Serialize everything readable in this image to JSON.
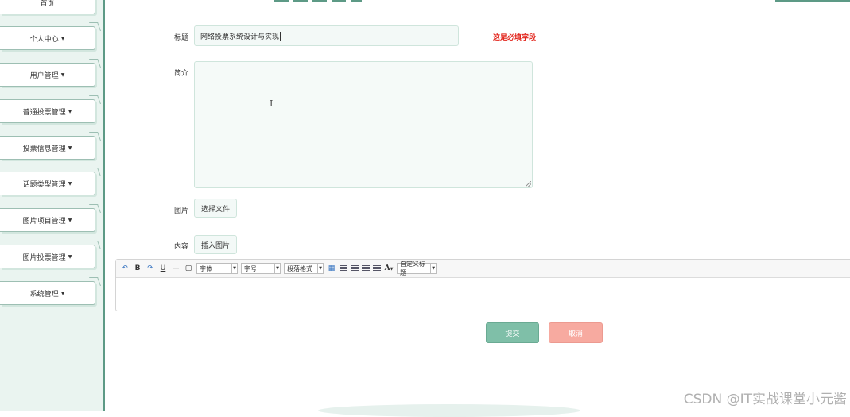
{
  "sidebar": {
    "items": [
      {
        "label": "首页",
        "caret": false
      },
      {
        "label": "个人中心",
        "caret": true
      },
      {
        "label": "用户管理",
        "caret": true
      },
      {
        "label": "普通投票管理",
        "caret": true
      },
      {
        "label": "投票信息管理",
        "caret": true
      },
      {
        "label": "话题类型管理",
        "caret": true
      },
      {
        "label": "图片项目管理",
        "caret": true
      },
      {
        "label": "图片投票管理",
        "caret": true
      },
      {
        "label": "系统管理",
        "caret": true
      }
    ]
  },
  "form": {
    "title_label": "标题",
    "title_value": "网络投票系统设计与实现",
    "required_hint": "这是必填字段",
    "intro_label": "简介",
    "image_label": "图片",
    "choose_file": "选择文件",
    "content_label": "内容",
    "insert_image": "插入图片"
  },
  "editor": {
    "font_family": "字体",
    "font_size": "字号",
    "paragraph_format": "段落格式",
    "custom_title": "自定义标题",
    "bold": "B",
    "underline": "U",
    "font_color": "A"
  },
  "actions": {
    "submit": "提交",
    "cancel": "取消"
  },
  "watermark": "CSDN @IT实战课堂小元酱",
  "colors": {
    "accent": "#5d9a86",
    "submit": "#7fbfa8",
    "cancel": "#f7aaa0",
    "required": "#e2231a"
  }
}
